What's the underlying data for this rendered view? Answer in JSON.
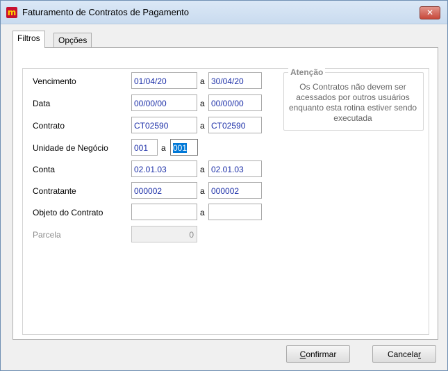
{
  "window": {
    "title": "Faturamento de Contratos de Pagamento",
    "close_icon": "✕"
  },
  "tabs": [
    {
      "label": "Filtros"
    },
    {
      "label": "Opções"
    }
  ],
  "separator": "a",
  "rows": [
    {
      "label": "Vencimento",
      "from": "01/04/20",
      "to": "30/04/20"
    },
    {
      "label": "Data",
      "from": "00/00/00",
      "to": "00/00/00"
    },
    {
      "label": "Contrato",
      "from": "CT02590",
      "to": "CT02590"
    },
    {
      "label": "Unidade de Negócio",
      "from": "001",
      "to": "001"
    },
    {
      "label": "Conta",
      "from": "02.01.03",
      "to": "02.01.03"
    },
    {
      "label": "Contratante",
      "from": "000002",
      "to": "000002"
    },
    {
      "label": "Objeto do Contrato",
      "from": "",
      "to": ""
    },
    {
      "label": "Parcela",
      "value": "0"
    }
  ],
  "notice": {
    "title": "Atenção",
    "text": "Os Contratos não devem ser acessados por outros usuários enquanto esta rotina estiver sendo executada"
  },
  "buttons": {
    "confirm": {
      "first": "C",
      "rest": "onfirmar"
    },
    "cancel": {
      "lead": "Cancela",
      "last": "r"
    }
  }
}
